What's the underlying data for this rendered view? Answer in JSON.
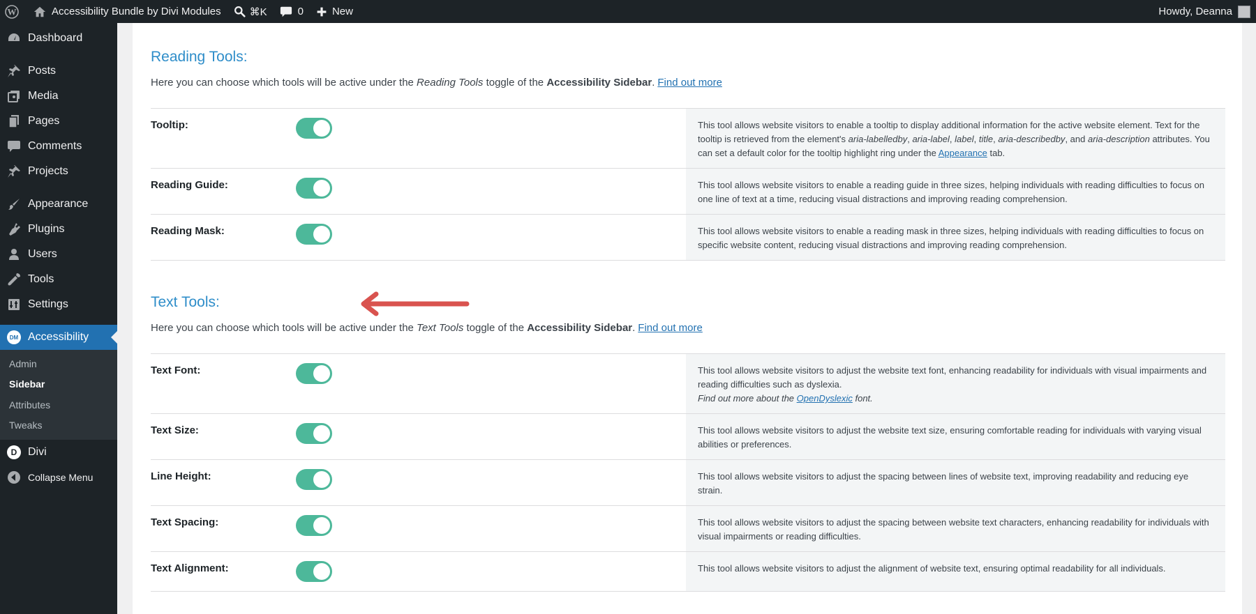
{
  "admin_bar": {
    "site_name": "Accessibility Bundle by Divi Modules",
    "search_shortcut": "⌘K",
    "comments_count": "0",
    "new_label": "New",
    "howdy": "Howdy, Deanna"
  },
  "menu": {
    "dashboard": "Dashboard",
    "posts": "Posts",
    "media": "Media",
    "pages": "Pages",
    "comments": "Comments",
    "projects": "Projects",
    "appearance": "Appearance",
    "plugins": "Plugins",
    "users": "Users",
    "tools": "Tools",
    "settings": "Settings",
    "accessibility": "Accessibility",
    "accessibility_badge": "DM",
    "submenu": [
      "Admin",
      "Sidebar",
      "Attributes",
      "Tweaks"
    ],
    "divi": "Divi",
    "divi_badge": "D",
    "collapse": "Collapse Menu"
  },
  "reading_tools": {
    "title": "Reading Tools:",
    "desc_pre": "Here you can choose which tools will be active under the ",
    "desc_em": "Reading Tools",
    "desc_mid": " toggle of the ",
    "desc_strong": "Accessibility Sidebar",
    "desc_post": ".",
    "link": "Find out more",
    "rows": [
      {
        "label": "Tooltip:",
        "enabled": true,
        "d1": "This tool allows website visitors to enable a tooltip to display additional information for the active website element. Text for the tooltip is retrieved from the element's ",
        "e1": "aria-labelledby",
        "c1": ", ",
        "e2": "aria-label",
        "c2": ", ",
        "e3": "label",
        "c3": ", ",
        "e4": "title",
        "c4": ", ",
        "e5": "aria-describedby",
        "c5": ", and ",
        "e6": "aria-description",
        "d2": " attributes. You can set a default color for the tooltip highlight ring under the ",
        "link": "Appearance",
        "d3": " tab."
      },
      {
        "label": "Reading Guide:",
        "enabled": true,
        "desc": "This tool allows website visitors to enable a reading guide in three sizes, helping individuals with reading difficulties to focus on one line of text at a time, reducing visual distractions and improving reading comprehension."
      },
      {
        "label": "Reading Mask:",
        "enabled": true,
        "desc": "This tool allows website visitors to enable a reading mask in three sizes, helping individuals with reading difficulties to focus on specific website content, reducing visual distractions and improving reading comprehension."
      }
    ]
  },
  "text_tools": {
    "title": "Text Tools:",
    "desc_pre": "Here you can choose which tools will be active under the ",
    "desc_em": "Text Tools",
    "desc_mid": " toggle of the ",
    "desc_strong": "Accessibility Sidebar",
    "desc_post": ".",
    "link": "Find out more",
    "rows": [
      {
        "label": "Text Font:",
        "enabled": true,
        "desc": "This tool allows website visitors to adjust the website text font, enhancing readability for individuals with visual impairments and reading difficulties such as dyslexia.",
        "note_pre": "Find out more about the ",
        "note_link": "OpenDyslexic",
        "note_post": " font."
      },
      {
        "label": "Text Size:",
        "enabled": true,
        "desc": "This tool allows website visitors to adjust the website text size, ensuring comfortable reading for individuals with varying visual abilities or preferences."
      },
      {
        "label": "Line Height:",
        "enabled": true,
        "desc": "This tool allows website visitors to adjust the spacing between lines of website text, improving readability and reducing eye strain."
      },
      {
        "label": "Text Spacing:",
        "enabled": true,
        "desc": "This tool allows website visitors to adjust the spacing between website text characters, enhancing readability for individuals with visual impairments or reading difficulties."
      },
      {
        "label": "Text Alignment:",
        "enabled": true,
        "desc": "This tool allows website visitors to adjust the alignment of website text, ensuring optimal readability for all individuals."
      }
    ]
  },
  "colors": {
    "toggle_on": "#4db89a",
    "section_title": "#2e8dc9",
    "menu_current": "#2271b1",
    "annotation_arrow": "#d9534f"
  }
}
